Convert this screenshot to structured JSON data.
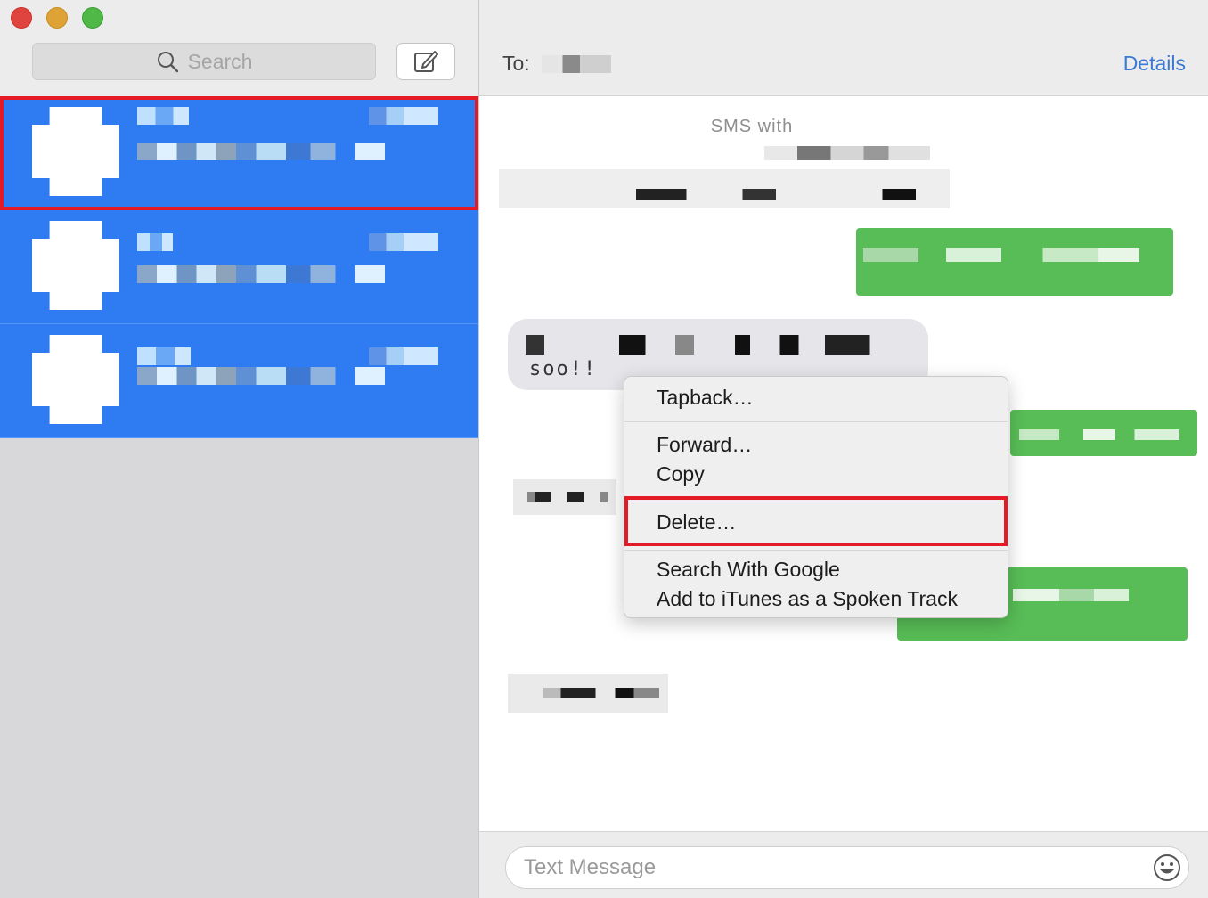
{
  "window": {
    "controls": [
      "close",
      "minimize",
      "maximize"
    ]
  },
  "sidebar": {
    "search": {
      "placeholder": "Search",
      "icon": "search-icon"
    },
    "compose": {
      "icon": "compose-icon"
    },
    "conversations": [
      {
        "selected": true
      },
      {
        "selected": false
      },
      {
        "selected": false
      }
    ]
  },
  "header": {
    "to_label": "To:",
    "details_label": "Details"
  },
  "transcript": {
    "sms_with_label": "SMS with",
    "incoming_fragment": "soo!!"
  },
  "context_menu": {
    "items": [
      {
        "label": "Tapback…"
      },
      {
        "label": "Forward…"
      },
      {
        "label": "Copy"
      },
      {
        "label": "Delete…",
        "highlighted": true
      },
      {
        "label": "Search With Google"
      },
      {
        "label": "Add to iTunes as a Spoken Track"
      }
    ]
  },
  "composer": {
    "placeholder": "Text Message",
    "emoji_icon": "emoji-icon"
  },
  "colors": {
    "selection_blue": "#2f7cf2",
    "highlight_red": "#e41a26",
    "sent_bubble": "#58bd56",
    "link_blue": "#3a7bd5"
  }
}
